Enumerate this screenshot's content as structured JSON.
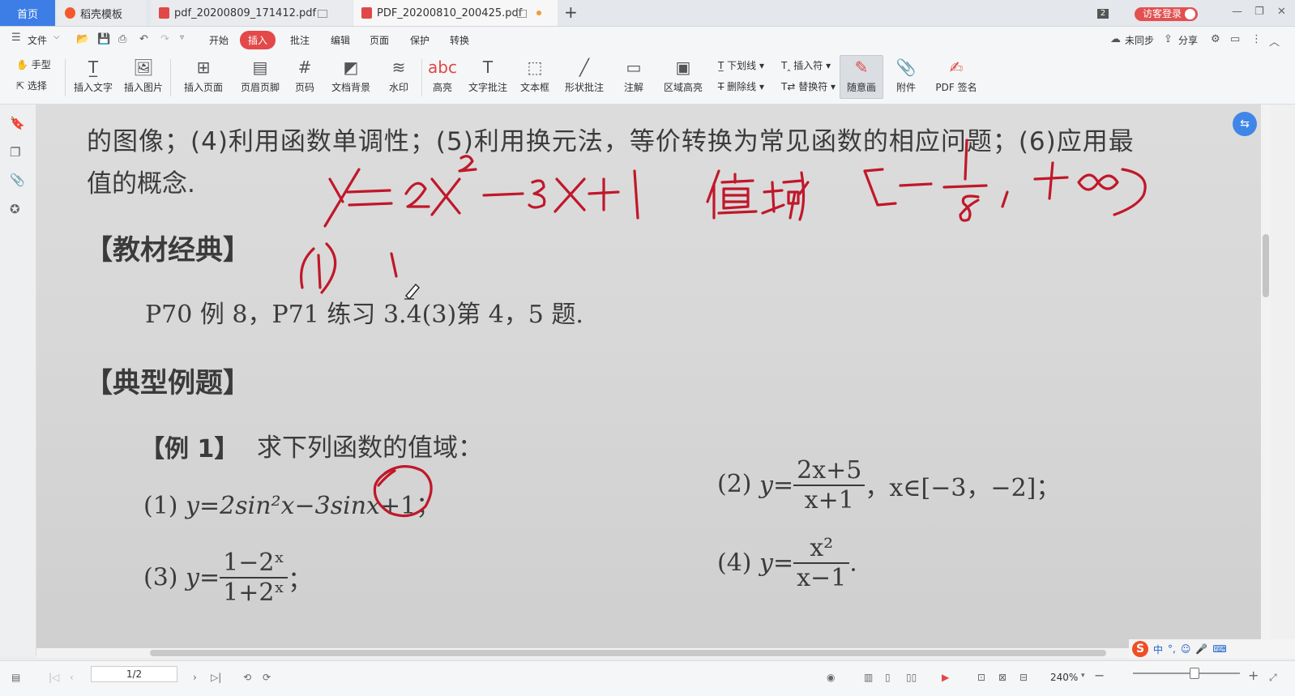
{
  "tabs": {
    "home": "首页",
    "t1": "稻壳模板",
    "t2": "pdf_20200809_171412.pdf",
    "t3": "PDF_20200810_200425.pdf",
    "new_tab": "+"
  },
  "titlebar": {
    "badge": "2",
    "login": "访客登录"
  },
  "menu": {
    "file": "文件",
    "items": [
      "开始",
      "插入",
      "批注",
      "编辑",
      "页面",
      "保护",
      "转换"
    ],
    "sync": "未同步",
    "share": "分享"
  },
  "ribbon": {
    "hand": "手型",
    "select": "选择",
    "insert_text": "插入文字",
    "insert_image": "插入图片",
    "insert_page": "插入页面",
    "header_footer": "页眉页脚",
    "page_number": "页码",
    "doc_background": "文档背景",
    "watermark": "水印",
    "highlight": "高亮",
    "text_comment": "文字批注",
    "textbox": "文本框",
    "shape_comment": "形状批注",
    "note": "注解",
    "area_highlight": "区域高亮",
    "underline": "下划线",
    "strikethrough": "删除线",
    "insert_mark": "插入符",
    "replace_mark": "替换符",
    "freehand": "随意画",
    "attachment": "附件",
    "pdf_sign": "PDF 签名"
  },
  "document": {
    "line1": "的图像；(4)利用函数单调性；(5)利用换元法，等价转换为常见函数的相应问题；(6)应用最",
    "line2": "值的概念.",
    "section1": "【教材经典】",
    "ref": "P70 例 8，P71 练习 3.4(3)第 4，5 题.",
    "section2": "【典型例题】",
    "example_label": "【例 1】",
    "example_prompt": "求下列函数的值域：",
    "p1_label": "(1)",
    "p1_expr_a": "y=2sin²x−3",
    "p1_expr_b": "sinx",
    "p1_expr_c": "+1；",
    "p2_label": "(2)",
    "p2_y": "y=",
    "p2_num": "2x+5",
    "p2_den": "x+1",
    "p2_tail": "，x∈[−3，−2]；",
    "p3_label": "(3)",
    "p3_y": "y=",
    "p3_num": "1−2ˣ",
    "p3_den": "1+2ˣ",
    "p3_tail": "；",
    "p4_label": "(4)",
    "p4_y": "y=",
    "p4_num": "x²",
    "p4_den": "x−1",
    "p4_tail": ".",
    "ink_color": "#c0182a"
  },
  "status": {
    "page": "1/2",
    "zoom": "240%"
  },
  "ime": {
    "items": [
      "中",
      "°,",
      "☺",
      "🎤",
      "⌨"
    ]
  }
}
